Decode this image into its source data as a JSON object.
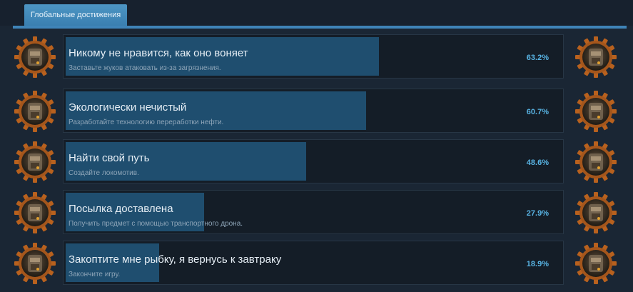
{
  "tabs": [
    {
      "label": "Глобальные достижения"
    }
  ],
  "accent_color": "#3f84b8",
  "achievements": [
    {
      "title": "Никому не нравится, как оно воняет",
      "description": "Заставьте жуков атаковать из-за загрязнения.",
      "percent_label": "63.2%",
      "percent": 63.2,
      "icon": "biter-gear-icon"
    },
    {
      "title": "Экологически нечистый",
      "description": "Разработайте технологию переработки нефти.",
      "percent_label": "60.7%",
      "percent": 60.7,
      "icon": "oil-refinery-gear-icon"
    },
    {
      "title": "Найти свой путь",
      "description": "Создайте локомотив.",
      "percent_label": "48.6%",
      "percent": 48.6,
      "icon": "locomotive-gear-icon"
    },
    {
      "title": "Посылка доставлена",
      "description": "Получить предмет с помощью транспортного дрона.",
      "percent_label": "27.9%",
      "percent": 27.9,
      "icon": "robot-drone-gear-icon"
    },
    {
      "title": "Закоптите мне рыбку, я вернусь к завтраку",
      "description": "Закончите игру.",
      "percent_label": "18.9%",
      "percent": 18.9,
      "icon": "rocket-gear-icon"
    }
  ]
}
